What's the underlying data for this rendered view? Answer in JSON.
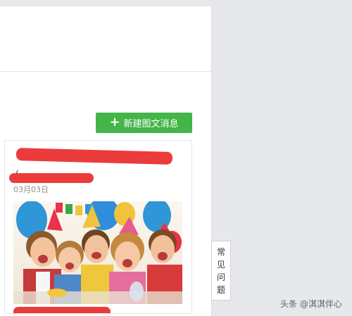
{
  "toolbar": {
    "new_button_label": "新建图文消息",
    "new_button_icon": "plus-icon"
  },
  "card": {
    "title_fragment_start": "【",
    "title_fragment_end": ",",
    "subtitle_fragment": "(",
    "date": "03月03日",
    "image_alt": "children celebrating a birthday party"
  },
  "faq": {
    "chars": [
      "常",
      "见",
      "问",
      "题"
    ]
  },
  "watermark": {
    "text": "头条 @淇淇伴心"
  },
  "colors": {
    "primary_green": "#44b549",
    "redaction_red": "#ec3b3b",
    "page_background": "#e7e8eb"
  }
}
